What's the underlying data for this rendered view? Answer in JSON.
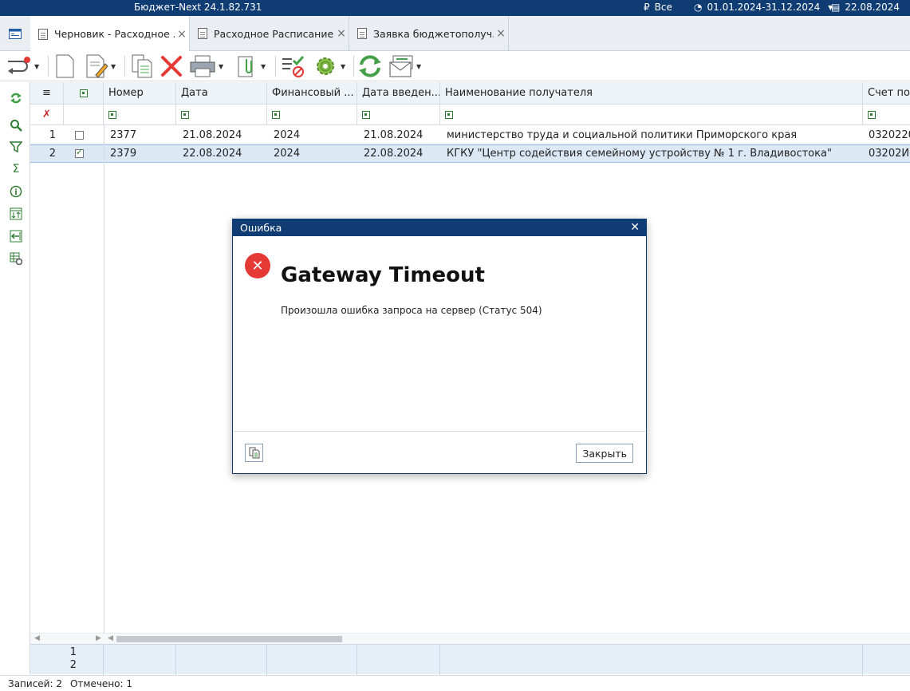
{
  "titlebar": {
    "app_title": "Бюджет-Next 24.1.82.731",
    "currency_filter": "Все",
    "period": "01.01.2024-31.12.2024",
    "date": "22.08.2024"
  },
  "tabs": [
    {
      "label": "Черновик - Расходное ..."
    },
    {
      "label": "Расходное Расписание..."
    },
    {
      "label": "Заявка бюджетополуч..."
    }
  ],
  "grid": {
    "columns": [
      "Номер",
      "Дата",
      "Финансовый ...",
      "Дата введен...",
      "Наименование получателя",
      "Счет пол"
    ],
    "rows": [
      {
        "num": "1",
        "checked": false,
        "cells": [
          "2377",
          "21.08.2024",
          "2024",
          "21.08.2024",
          "министерство труда и социальной политики Приморского края",
          "0320220"
        ]
      },
      {
        "num": "2",
        "checked": true,
        "cells": [
          "2379",
          "22.08.2024",
          "2024",
          "22.08.2024",
          "КГКУ \"Центр содействия семейному устройству № 1 г. Владивостока\"",
          "03202И"
        ]
      }
    ],
    "totals": [
      "1",
      "2"
    ]
  },
  "status": {
    "records": "Записей: 2",
    "marked": "Отмечено: 1"
  },
  "dialog": {
    "title": "Ошибка",
    "heading": "Gateway Timeout",
    "message": "Произошла ошибка запроса на сервер (Статус 504)",
    "close_label": "Закрыть"
  },
  "colors": {
    "accent": "#0f3d73",
    "error": "#e53935",
    "icon_green": "#2e7d32",
    "selection": "#dce9f5"
  }
}
